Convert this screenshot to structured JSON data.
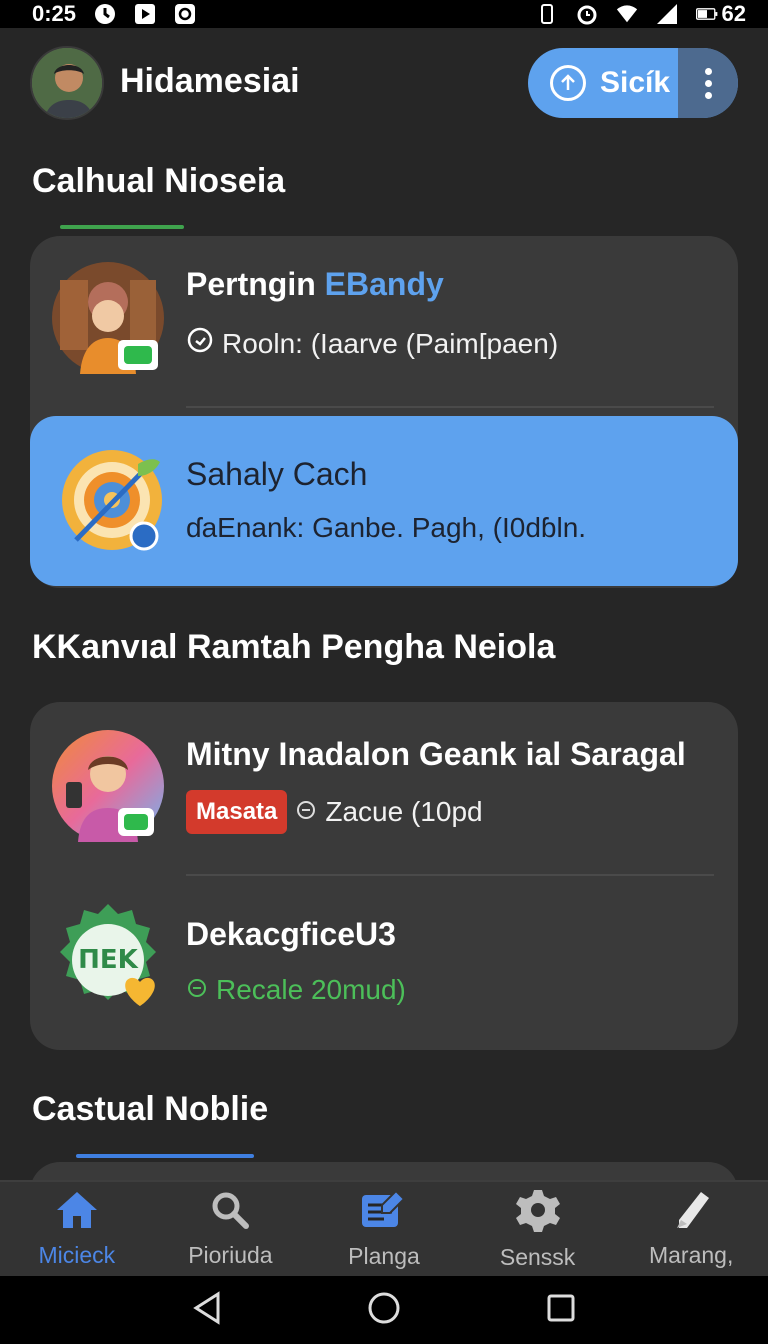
{
  "status_bar": {
    "time": "0:25",
    "battery": "62"
  },
  "header": {
    "title": "Hidamesiai",
    "action_label": "Sicík",
    "colors": {
      "accent": "#5ea2ee"
    }
  },
  "sections": [
    {
      "title": "Calhual Nioseia"
    },
    {
      "title": "KKanvıal Ramtah Pengha Neiola"
    },
    {
      "title": "Castual Noblie"
    }
  ],
  "items": [
    {
      "title": "Pertngin",
      "title_accent": "EBandy",
      "subtitle": "Roοln: (Iaarve (Paim[paen)"
    },
    {
      "title": "Sahaly Cach",
      "subtitle": "ɗaEnank:  Ganbe. Pagh, (I0dɓln."
    },
    {
      "title": "Mitny Inadalon  Geank ial Saragal",
      "badge": "Masata",
      "subtitle": "Zacue (10pd"
    },
    {
      "title": "DekacgficeU3",
      "subtitle": "Recale 20mud)",
      "icon_text": "ΠEK"
    }
  ],
  "bottom_nav": [
    {
      "label": "Micieck",
      "icon": "home-icon"
    },
    {
      "label": "Pioriuda",
      "icon": "search-icon"
    },
    {
      "label": "Planga",
      "icon": "notes-icon"
    },
    {
      "label": "Senssk",
      "icon": "gear-icon"
    },
    {
      "label": "Marang,",
      "icon": "pen-icon"
    }
  ]
}
